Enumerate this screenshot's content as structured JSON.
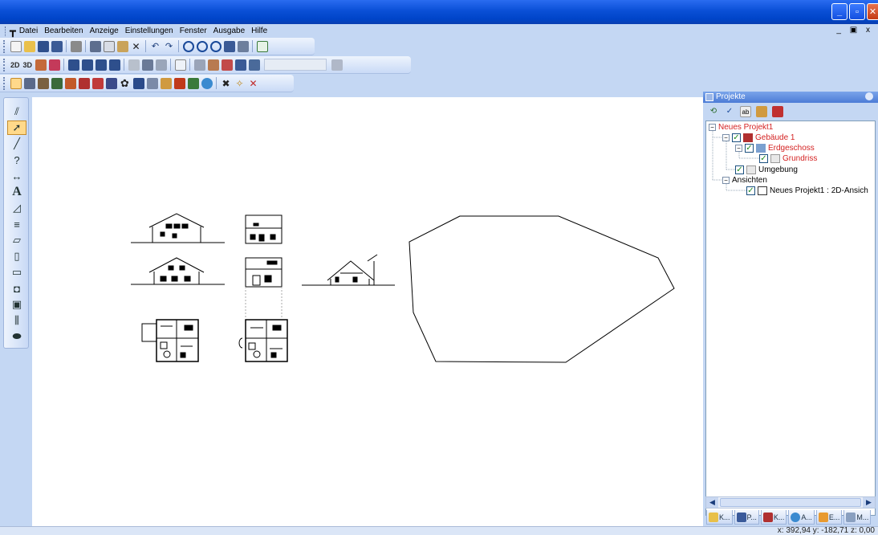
{
  "menu": {
    "items": [
      "Datei",
      "Bearbeiten",
      "Anzeige",
      "Einstellungen",
      "Fenster",
      "Ausgabe",
      "Hilfe"
    ],
    "mdi_controls": "_ 8 x"
  },
  "toolbar2": {
    "btn_2d": "2D",
    "btn_3d": "3D"
  },
  "projects_panel": {
    "title": "Projekte",
    "tree": {
      "root": "Neues Projekt1",
      "building": "Gebäude 1",
      "floor": "Erdgeschoss",
      "plan": "Grundriss",
      "environment": "Umgebung",
      "views": "Ansichten",
      "view_item": "Neues Projekt1 : 2D-Ansich"
    },
    "tabs": [
      "K...",
      "P...",
      "K...",
      "A...",
      "E...",
      "M..."
    ]
  },
  "status": {
    "coords": "x: 392,94 y: -182,71 z:  0,00"
  },
  "colors": {
    "titlebar": "#0a4fd6",
    "toolbar_bg": "#c4d7f3",
    "tree_red": "#d42222",
    "checkbox_green": "#1e8a1e"
  },
  "icons": {
    "left_tools": [
      "wall-tool-icon",
      "pointer-icon",
      "line-tool-icon",
      "query-icon",
      "dimension-icon",
      "text-icon",
      "stairs-icon",
      "roof-icon",
      "beam-icon",
      "column-icon",
      "door-icon",
      "window-icon",
      "opening-icon",
      "railing-icon",
      "wall-edit-icon",
      "eraser-icon"
    ]
  }
}
